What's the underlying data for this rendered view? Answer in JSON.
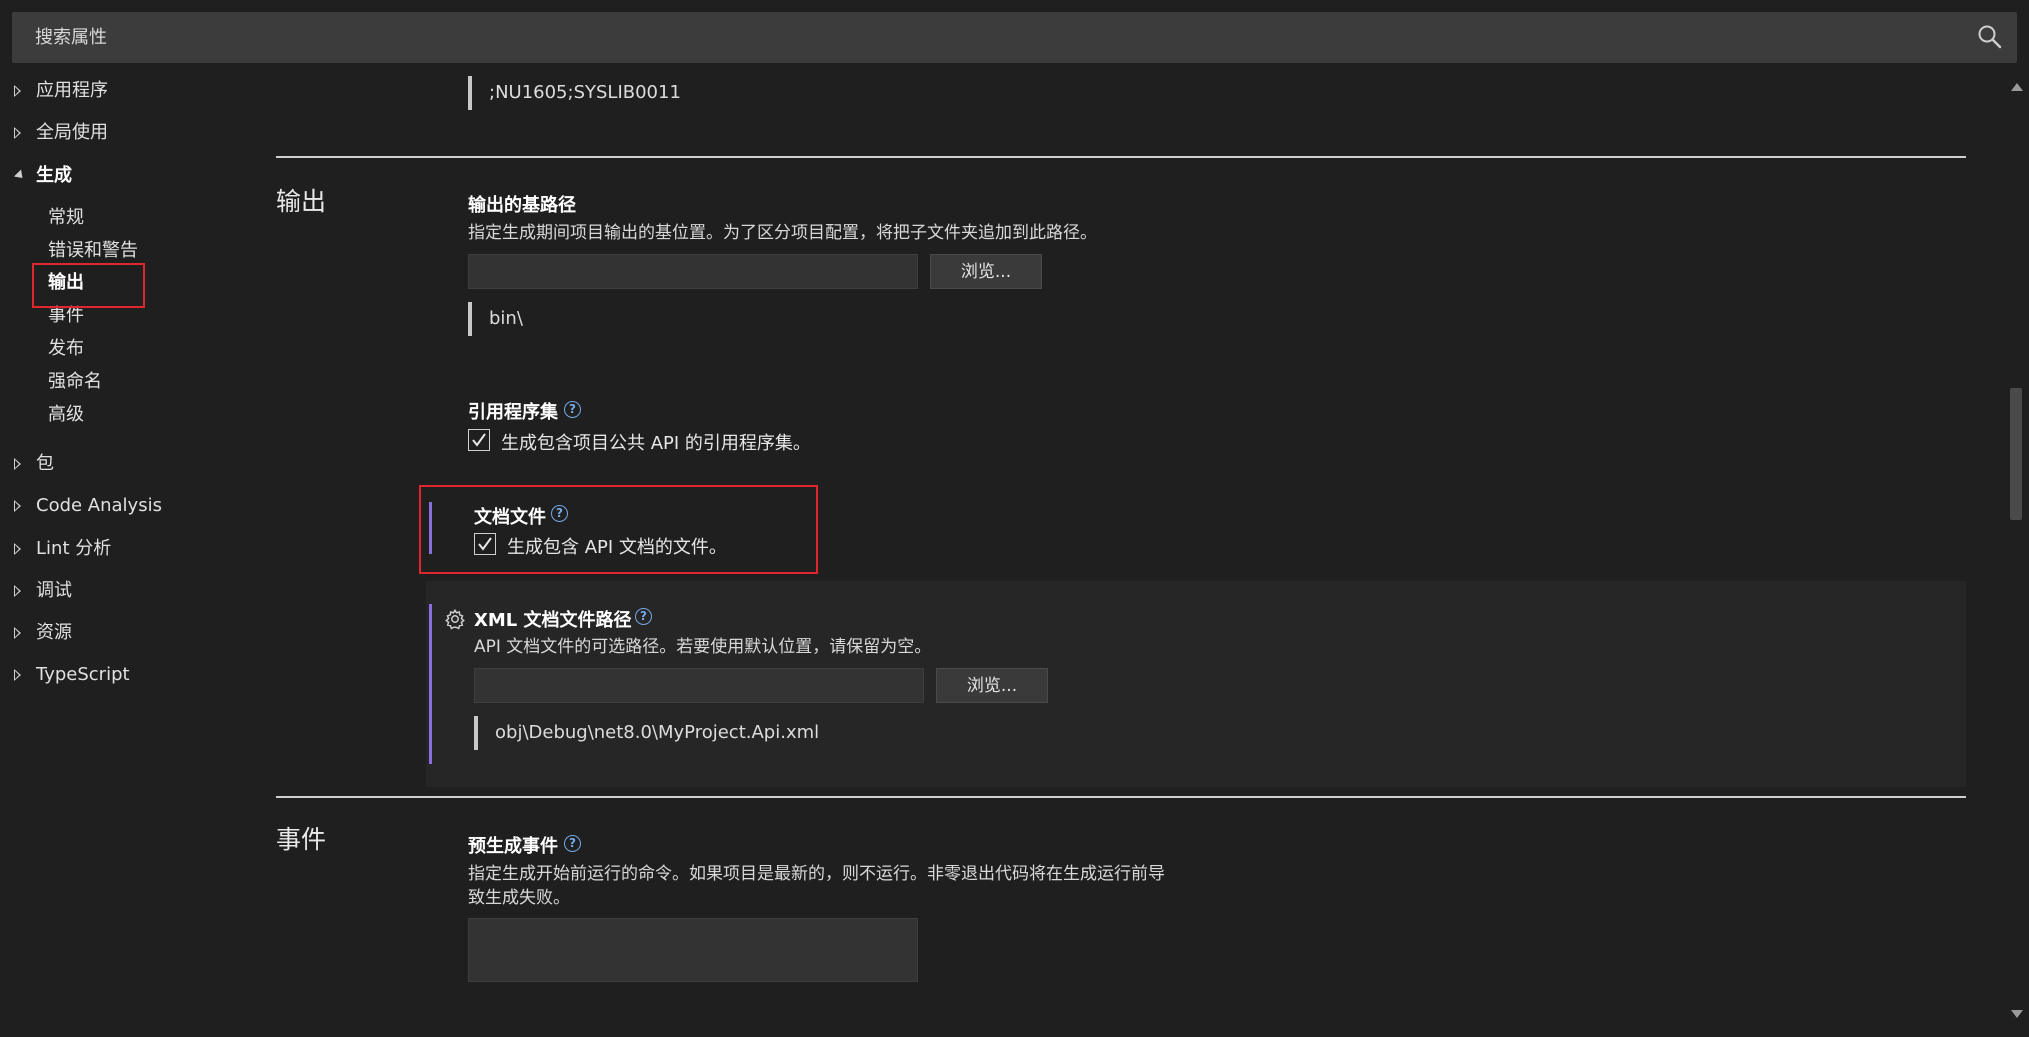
{
  "search": {
    "placeholder": "搜索属性"
  },
  "sidebar": {
    "items": [
      {
        "label": "应用程序",
        "expanded": false
      },
      {
        "label": "全局使用",
        "expanded": false
      },
      {
        "label": "生成",
        "expanded": true
      },
      {
        "label": "包",
        "expanded": false
      },
      {
        "label": "Code Analysis",
        "expanded": false
      },
      {
        "label": "Lint 分析",
        "expanded": false
      },
      {
        "label": "调试",
        "expanded": false
      },
      {
        "label": "资源",
        "expanded": false
      },
      {
        "label": "TypeScript",
        "expanded": false
      }
    ],
    "build_children": [
      "常规",
      "错误和警告",
      "输出",
      "事件",
      "发布",
      "强命名",
      "高级"
    ],
    "selected": "输出"
  },
  "top_default_value": ";NU1605;SYSLIB0011",
  "sections": {
    "output": {
      "title": "输出",
      "base_path": {
        "title": "输出的基路径",
        "description": "指定生成期间项目输出的基位置。为了区分项目配置，将把子文件夹追加到此路径。",
        "value": "",
        "browse_label": "浏览...",
        "default_value": "bin\\"
      },
      "reference_assembly": {
        "title": "引用程序集",
        "help": "?",
        "checkbox_label": "生成包含项目公共 API 的引用程序集。",
        "checked": true
      },
      "doc_file": {
        "title": "文档文件",
        "help": "?",
        "checkbox_label": "生成包含 API 文档的文件。",
        "checked": true
      },
      "xml_doc_path": {
        "title": "XML 文档文件路径",
        "help": "?",
        "description": "API 文档文件的可选路径。若要使用默认位置，请保留为空。",
        "value": "",
        "browse_label": "浏览...",
        "default_value": "obj\\Debug\\net8.0\\MyProject.Api.xml"
      }
    },
    "events": {
      "title": "事件",
      "pre_build": {
        "title": "预生成事件",
        "help": "?",
        "description_line1": "指定生成开始前运行的命令。如果项目是最新的，则不运行。非零退出代码将在生成运行前导",
        "description_line2": "致生成失败。",
        "value": ""
      }
    }
  },
  "colors": {
    "background": "#1f1f1f",
    "highlight": "#e0252b",
    "accent": "#8a6fe0",
    "help": "#75a8e6"
  }
}
